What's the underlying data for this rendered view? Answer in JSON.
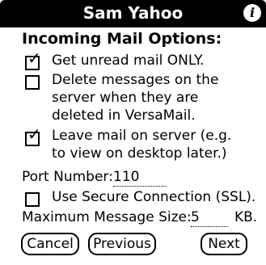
{
  "window": {
    "title": "Sam Yahoo",
    "info_glyph": "i"
  },
  "heading": "Incoming Mail Options:",
  "options": [
    {
      "checked": true,
      "lines": [
        "Get unread mail ONLY."
      ]
    },
    {
      "checked": false,
      "lines": [
        "Delete messages on the",
        "server when they are",
        "deleted in VersaMail."
      ]
    },
    {
      "checked": true,
      "lines": [
        "Leave mail on server (e.g.",
        "to view on desktop later.)"
      ]
    }
  ],
  "port": {
    "label": "Port Number:",
    "value": "110"
  },
  "ssl": {
    "checked": false,
    "label": "Use Secure Connection (SSL)."
  },
  "max_size": {
    "label": "Maximum Message Size:",
    "value": "5",
    "unit": "KB."
  },
  "buttons": {
    "cancel": "Cancel",
    "previous": "Previous",
    "next": "Next"
  },
  "check_glyph": "✓"
}
